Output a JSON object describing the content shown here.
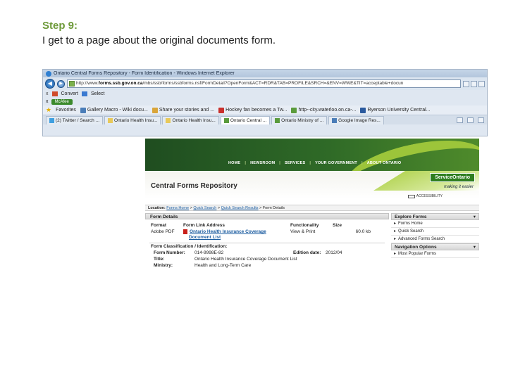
{
  "slide": {
    "step_title": "Step 9:",
    "description": "I get to a page about the original documents form."
  },
  "browser": {
    "title": "Ontario Central Forms Repository - Form Identification - Windows Internet Explorer",
    "url_prefix": "http://www.",
    "url_domain": "forms.ssb.gov.on.ca",
    "url_rest": "/mbs/ssb/forms/ssbforms.nsf/FormDetail?OpenForm&ACT=RDR&TAB=PROFILE&SRCH=&ENV=WWE&TIT=acceptable+docun",
    "cmd": {
      "x": "x",
      "convert": "Convert",
      "select": "Select",
      "mcafee": "McAfee"
    },
    "favorites": {
      "label": "Favorites",
      "items": [
        "Gallery Macro - Wiki docu...",
        "Share your stories and ...",
        "Hockey fan becomes a Tw...",
        "http--city.waterloo.on.ca-...",
        "Ryerson University Central..."
      ]
    },
    "tabs": [
      {
        "label": "(2) Twitter / Search ..."
      },
      {
        "label": "Ontario Health Insu..."
      },
      {
        "label": "Ontario Health Insu..."
      },
      {
        "label": "Ontario Central ..."
      },
      {
        "label": "Ontario Ministry of ..."
      },
      {
        "label": "Google Image Res..."
      }
    ]
  },
  "site": {
    "nav": [
      "HOME",
      "NEWSROOM",
      "SERVICES",
      "YOUR GOVERNMENT",
      "ABOUT ONTARIO"
    ],
    "title": "Central Forms Repository",
    "logo": "ServiceOntario",
    "tagline": "making it easier",
    "accessibility": "ACCESSIBILITY",
    "breadcrumb": {
      "label": "Location:",
      "items": [
        "Forms Home",
        "Quick Search",
        "Quick Search Results"
      ],
      "current": "Form Details"
    }
  },
  "form_details": {
    "section_title": "Form Details",
    "headers": [
      "Format",
      "Form Link Address",
      "Functionality",
      "Size"
    ],
    "row": {
      "format": "Adobe PDF",
      "link_line1": "Ontario Health Insurance Coverage",
      "link_line2": "Document List",
      "functionality": "View & Print",
      "size": "60.0 kb"
    },
    "classification_title": "Form Classification / Identification:",
    "form_number_label": "Form Number:",
    "form_number": "014-9998E-82",
    "edition_label": "Edition date:",
    "edition": "2012/04",
    "title_label": "Title:",
    "title": "Ontario Health Insurance Coverage Document List",
    "ministry_label": "Ministry:",
    "ministry": "Health and Long-Term Care"
  },
  "sidebar": {
    "explore_title": "Explore Forms",
    "explore_items": [
      "Forms Home",
      "Quick Search",
      "Advanced Forms Search"
    ],
    "nav_title": "Navigation Options",
    "nav_items": [
      "Most Popular Forms"
    ]
  }
}
